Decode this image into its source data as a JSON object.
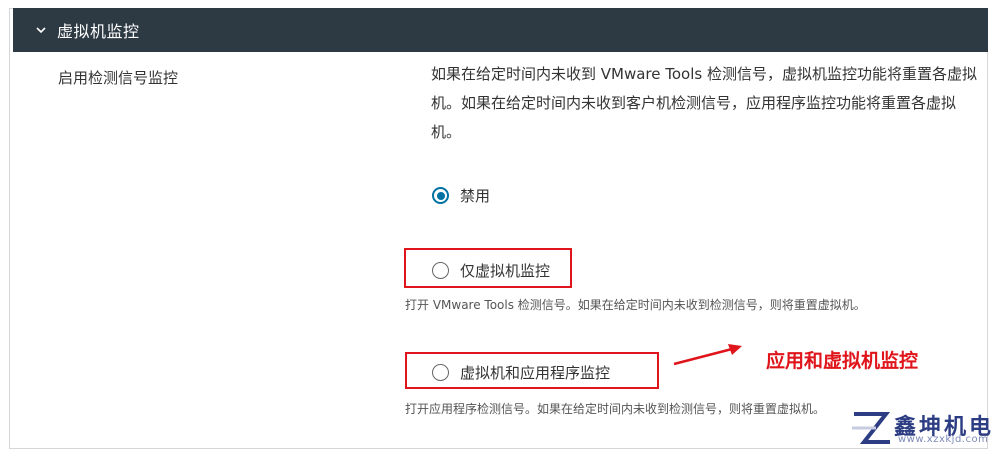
{
  "section": {
    "title": "虚拟机监控"
  },
  "setting": {
    "label": "启用检测信号监控",
    "description": "如果在给定时间内未收到 VMware Tools 检测信号，虚拟机监控功能将重置各虚拟机。如果在给定时间内未收到客户机检测信号，应用程序监控功能将重置各虚拟机。"
  },
  "options": [
    {
      "label": "禁用",
      "checked": true,
      "hint": ""
    },
    {
      "label": "仅虚拟机监控",
      "checked": false,
      "hint": "打开 VMware Tools 检测信号。如果在给定时间内未收到检测信号，则将重置虚拟机。"
    },
    {
      "label": "虚拟机和应用程序监控",
      "checked": false,
      "hint": "打开应用程序检测信号。如果在给定时间内未收到检测信号，则将重置虚拟机。"
    }
  ],
  "annotation": {
    "text": "应用和虚拟机监控",
    "color": "#e0151b"
  },
  "watermark": {
    "name": "鑫坤机电",
    "url": "www.xzxkjd.com"
  },
  "colors": {
    "header_bg": "#2e3a43",
    "radio_accent": "#0072a3",
    "highlight": "#e0151b"
  }
}
